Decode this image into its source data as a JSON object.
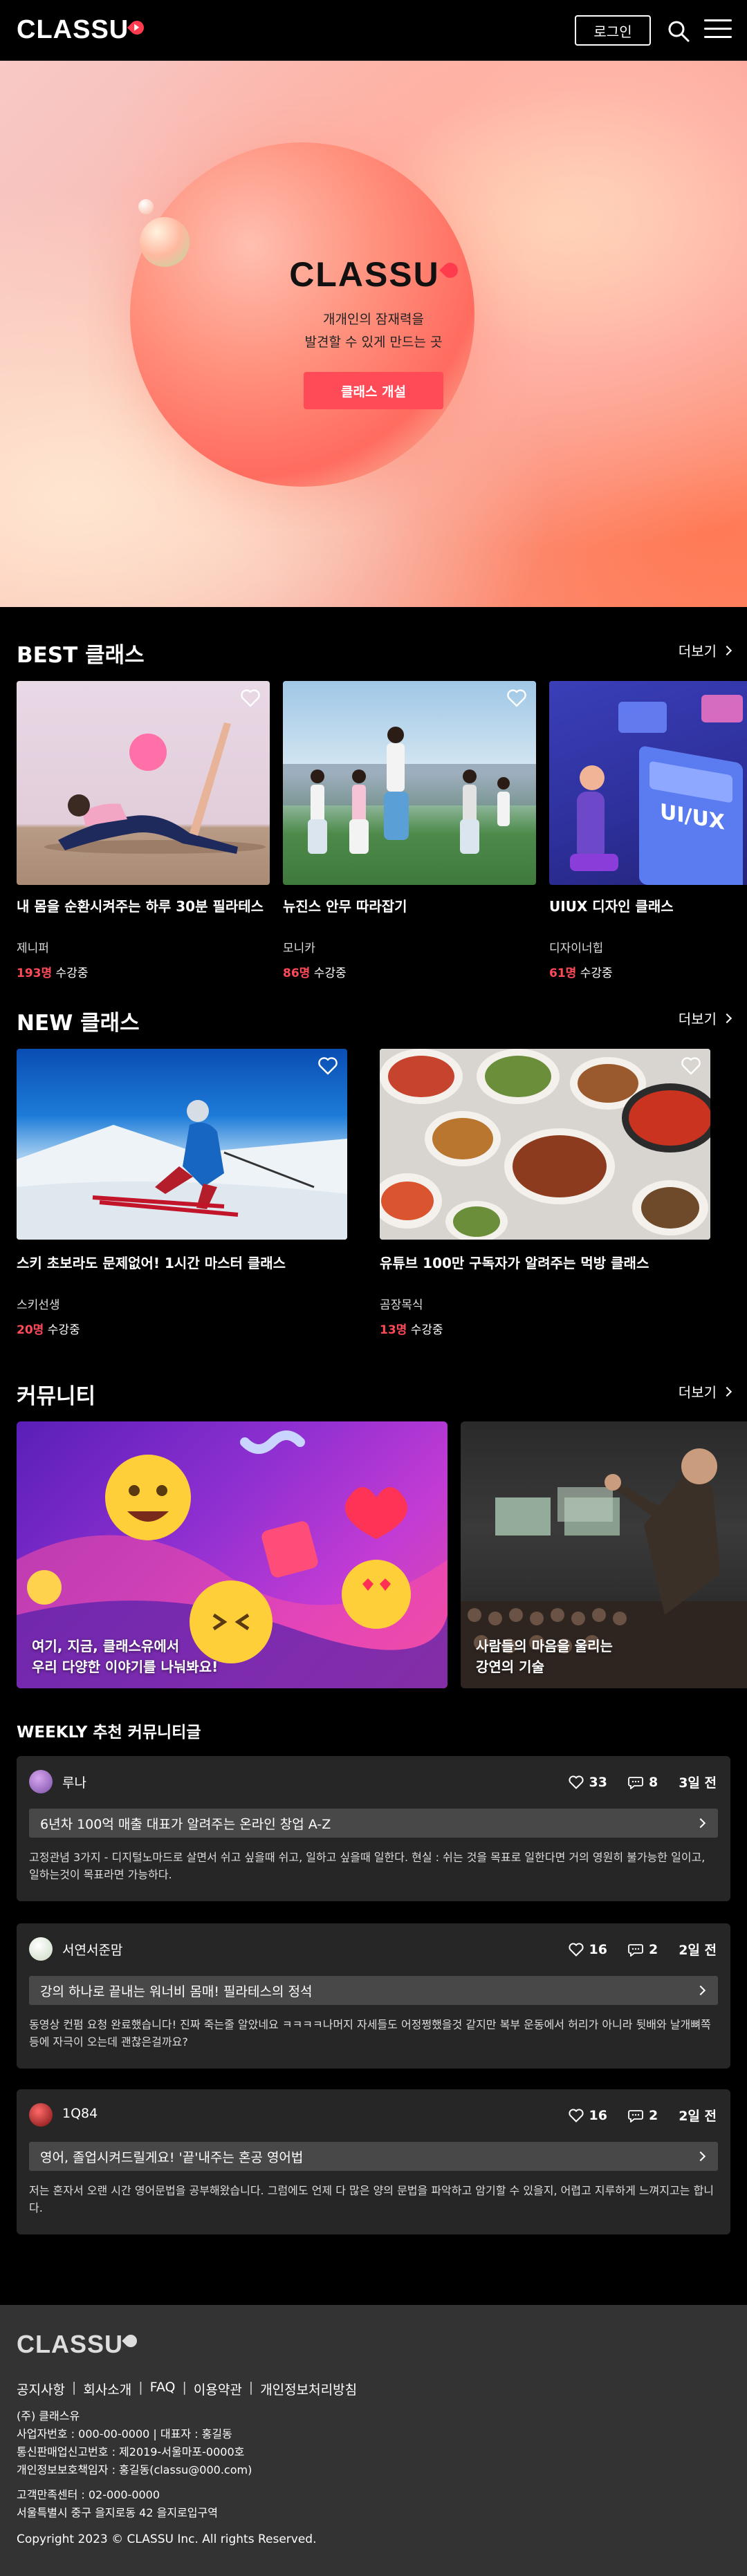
{
  "header": {
    "logo": "CLASSU",
    "login_label": "로그인"
  },
  "hero": {
    "logo": "CLASSU",
    "subtitle_line1": "개개인의 잠재력을",
    "subtitle_line2": "발견할 수 있게 만드는 곳",
    "cta_label": "클래스 개설"
  },
  "best": {
    "title": "BEST 클래스",
    "more_label": "더보기",
    "items": [
      {
        "title": "내 몸을 순환시켜주는 하루 30분 필라테스",
        "author": "제니퍼",
        "count": "193명",
        "count_suffix": "수강중"
      },
      {
        "title": "뉴진스 안무 따라잡기",
        "author": "모니카",
        "count": "86명",
        "count_suffix": "수강중"
      },
      {
        "title": "UIUX 디자인 클래스",
        "author": "디자이너힙",
        "count": "61명",
        "count_suffix": "수강중"
      }
    ]
  },
  "new": {
    "title": "NEW 클래스",
    "more_label": "더보기",
    "items": [
      {
        "title": "스키 초보라도 문제없어! 1시간 마스터 클래스",
        "author": "스키선생",
        "count": "20명",
        "count_suffix": "수강중"
      },
      {
        "title": "유튜브 100만 구독자가 알려주는 먹방 클래스",
        "author": "곰장목식",
        "count": "13명",
        "count_suffix": "수강중"
      }
    ]
  },
  "community": {
    "title": "커뮤니티",
    "more_label": "더보기",
    "banners": [
      {
        "line1": "여기, 지금, 클래스유에서",
        "line2": "우리 다양한 이야기를 나눠봐요!"
      },
      {
        "line1": "사람들의 마음을 울리는",
        "line2": "강연의 기술"
      }
    ]
  },
  "weekly": {
    "title": "WEEKLY 추천 커뮤니티글",
    "posts": [
      {
        "user": "루나",
        "likes": "33",
        "comments": "8",
        "time": "3일 전",
        "title": "6년차 100억 매출 대표가 알려주는 온라인 창업 A-Z",
        "body": "고정관념 3가지 - 디지털노마드로 살면서 쉬고 싶을때 쉬고, 일하고 싶을때 일한다. 현실 : 쉬는 것을 목표로 일한다면 거의 영원히 불가능한 일이고, 일하는것이 목표라면 가능하다."
      },
      {
        "user": "서연서준맘",
        "likes": "16",
        "comments": "2",
        "time": "2일 전",
        "title": "강의 하나로 끝내는 워너비 몸매! 필라테스의 정석",
        "body": "동영상 컨펌 요청 완료했습니다! 진짜 죽는줄 알았네요 ㅋㅋㅋㅋ나머지 자세들도 어정쩡했을것 같지만 복부 운동에서 허리가 아니라 뒷배와 날개뼈쪽 등에 자극이 오는데 괜찮은걸까요?"
      },
      {
        "user": "1Q84",
        "likes": "16",
        "comments": "2",
        "time": "2일 전",
        "title": "영어, 졸업시켜드릴게요! '끝'내주는 혼공 영어법",
        "body": "저는 혼자서 오랜 시간 영어문법을 공부해왔습니다. 그럼에도 언제 다 많은 양의 문법을 파악하고 암기할 수 있을지, 어렵고 지루하게 느껴지고는 합니다."
      }
    ]
  },
  "footer": {
    "logo": "CLASSU",
    "links": [
      "공지사항",
      "회사소개",
      "FAQ",
      "이용약관",
      "개인정보처리방침"
    ],
    "company": "(주) 클래스유",
    "biz_line": "사업자번호 : 000-00-0000  |  대표자 : 홍길동",
    "sales_line": "통신판매업신고번호 : 제2019-서울마포-0000호",
    "privacy_line": "개인정보보호책임자 : 홍길동(classu@000.com)",
    "cs_line": "고객만족센터 : 02-000-0000",
    "address_line": "서울특별시 중구 을지로동 42 을지로입구역",
    "copyright": "Copyright 2023 © CLASSU Inc. All rights Reserved."
  }
}
